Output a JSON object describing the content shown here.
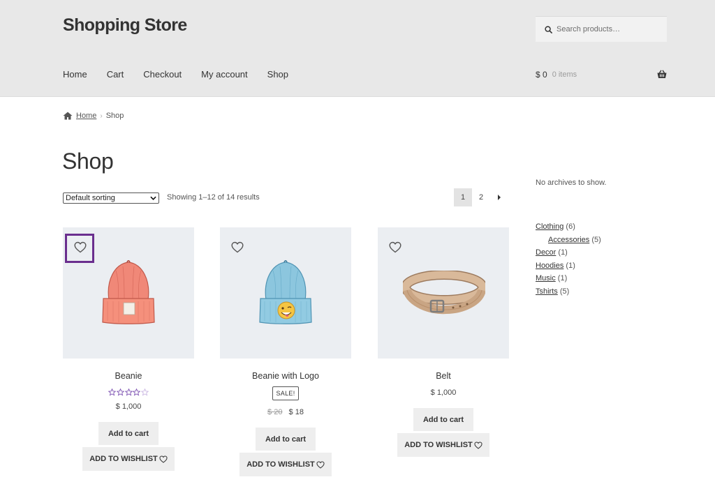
{
  "header": {
    "site_title": "Shopping Store",
    "search_placeholder": "Search products…",
    "nav": [
      "Home",
      "Cart",
      "Checkout",
      "My account",
      "Shop"
    ],
    "cart_amount": "$ 0",
    "cart_count": "0 items"
  },
  "breadcrumb": {
    "home": "Home",
    "current": "Shop"
  },
  "page_title": "Shop",
  "toolbar": {
    "sorting_selected": "Default sorting",
    "result_count": "Showing 1–12 of 14 results",
    "pages": [
      "1",
      "2"
    ],
    "current_page": "1"
  },
  "products": [
    {
      "name": "Beanie",
      "rating": 3.5,
      "rating_max": 5,
      "price": "$ 1,000",
      "add_to_cart": "Add to cart",
      "add_to_wishlist": "ADD TO WISHLIST"
    },
    {
      "name": "Beanie with Logo",
      "badge": "SALE!",
      "old_price": "$ 20",
      "price": "$ 18",
      "add_to_cart": "Add to cart",
      "add_to_wishlist": "ADD TO WISHLIST"
    },
    {
      "name": "Belt",
      "price": "$ 1,000",
      "add_to_cart": "Add to cart",
      "add_to_wishlist": "ADD TO WISHLIST"
    }
  ],
  "sidebar": {
    "archives_text": "No archives to show.",
    "categories": [
      {
        "name": "Clothing",
        "count": "(6)"
      },
      {
        "name": "Accessories",
        "count": "(5)"
      },
      {
        "name": "Decor",
        "count": "(1)"
      },
      {
        "name": "Hoodies",
        "count": "(1)"
      },
      {
        "name": "Music",
        "count": "(1)"
      },
      {
        "name": "Tshirts",
        "count": "(5)"
      }
    ]
  },
  "colors": {
    "header_bg": "#e8e8e8",
    "focus_outline": "#6a2e8e",
    "star": "#7f54b3",
    "product_bg": "#ebeef2"
  }
}
